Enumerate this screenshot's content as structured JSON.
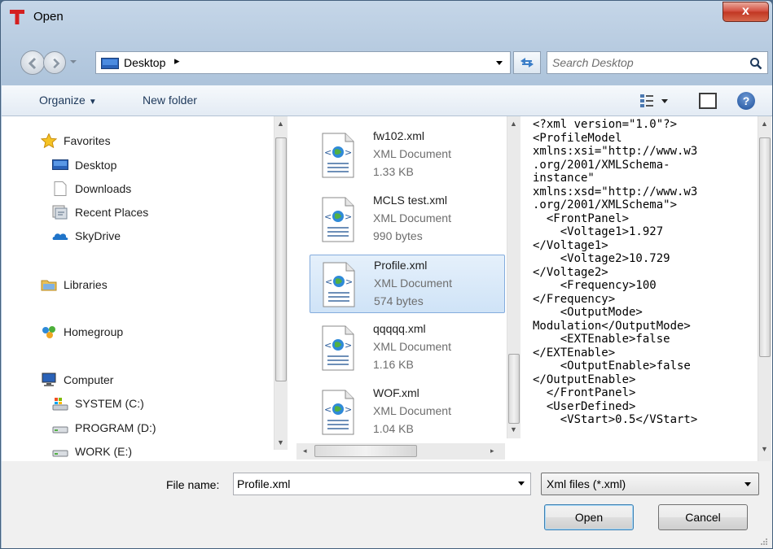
{
  "window": {
    "title": "Open",
    "close_label": "x"
  },
  "address": {
    "location": "Desktop",
    "separator": "▸"
  },
  "search": {
    "placeholder": "Search Desktop"
  },
  "toolbar": {
    "organize_label": "Organize",
    "new_folder_label": "New folder",
    "help_label": "?"
  },
  "nav": {
    "items": [
      {
        "label": "Favorites",
        "icon": "star-icon"
      },
      {
        "label": "Desktop",
        "icon": "desktop-icon"
      },
      {
        "label": "Downloads",
        "icon": "downloads-icon"
      },
      {
        "label": "Recent Places",
        "icon": "recent-places-icon"
      },
      {
        "label": "SkyDrive",
        "icon": "skydrive-icon"
      },
      {
        "label": "Libraries",
        "icon": "libraries-icon"
      },
      {
        "label": "Homegroup",
        "icon": "homegroup-icon"
      },
      {
        "label": "Computer",
        "icon": "computer-icon"
      },
      {
        "label": "SYSTEM (C:)",
        "icon": "system-drive-icon"
      },
      {
        "label": "PROGRAM (D:)",
        "icon": "drive-icon"
      },
      {
        "label": "WORK (E:)",
        "icon": "drive-icon"
      }
    ]
  },
  "files": [
    {
      "name": "fw102.xml",
      "type": "XML Document",
      "size": "1.33 KB",
      "selected": false
    },
    {
      "name": "MCLS test.xml",
      "type": "XML Document",
      "size": "990 bytes",
      "selected": false
    },
    {
      "name": "Profile.xml",
      "type": "XML Document",
      "size": "574 bytes",
      "selected": true
    },
    {
      "name": "qqqqq.xml",
      "type": "XML Document",
      "size": "1.16 KB",
      "selected": false
    },
    {
      "name": "WOF.xml",
      "type": "XML Document",
      "size": "1.04 KB",
      "selected": false
    }
  ],
  "preview": {
    "text": "<?xml version=\"1.0\"?>\n<ProfileModel\nxmlns:xsi=\"http://www.w3\n.org/2001/XMLSchema-\ninstance\"\nxmlns:xsd=\"http://www.w3\n.org/2001/XMLSchema\">\n  <FrontPanel>\n    <Voltage1>1.927\n</Voltage1>\n    <Voltage2>10.729\n</Voltage2>\n    <Frequency>100\n</Frequency>\n    <OutputMode>\nModulation</OutputMode>\n    <EXTEnable>false\n</EXTEnable>\n    <OutputEnable>false\n</OutputEnable>\n  </FrontPanel>\n  <UserDefined>\n    <VStart>0.5</VStart>"
  },
  "bottom": {
    "file_name_label": "File name:",
    "file_name_value": "Profile.xml",
    "file_type_value": "Xml files (*.xml)",
    "open_label": "Open",
    "cancel_label": "Cancel"
  },
  "colors": {
    "selection": "#cfe3f7",
    "selection_border": "#84acdd",
    "close": "#c13622",
    "accent": "#1e395b"
  }
}
